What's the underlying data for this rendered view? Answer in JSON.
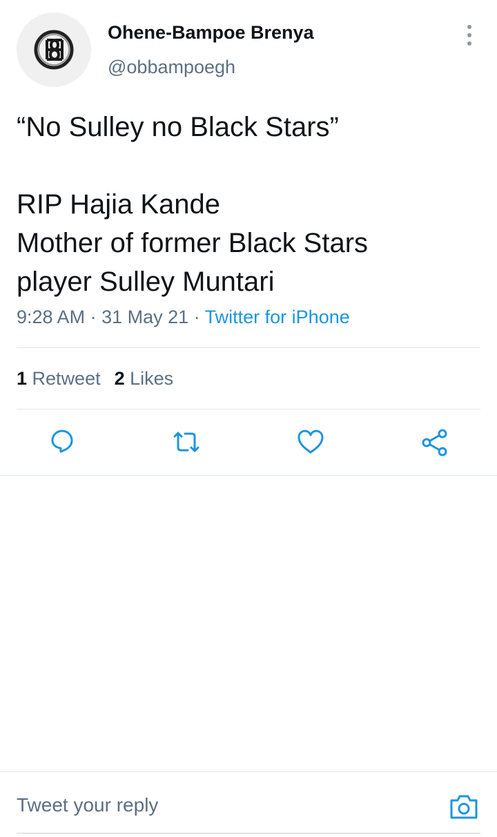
{
  "author": {
    "display_name": "Ohene-Bampoe Brenya",
    "handle": "@obbampoegh",
    "avatar_icon": "bb-monogram-logo"
  },
  "tweet": {
    "lines": [
      "“No Sulley no Black Stars”",
      "",
      "RIP Hajia Kande",
      "Mother of former Black Stars",
      "player Sulley Muntari"
    ],
    "time": "9:28 AM",
    "separator": " · ",
    "date": "31 May 21",
    "source": "Twitter for iPhone"
  },
  "stats": {
    "retweet_count": "1",
    "retweet_label": "Retweet",
    "like_count": "2",
    "like_label": "Likes"
  },
  "actions": {
    "icons": [
      "reply-icon",
      "retweet-icon",
      "like-icon",
      "share-icon"
    ],
    "color": "#1b95e0"
  },
  "reply_bar": {
    "placeholder": "Tweet your reply",
    "camera_icon": "camera-icon"
  },
  "colors": {
    "text": "#0f1419",
    "secondary": "#5b7083",
    "accent": "#1b95e0",
    "divider": "#e1e8ed"
  }
}
